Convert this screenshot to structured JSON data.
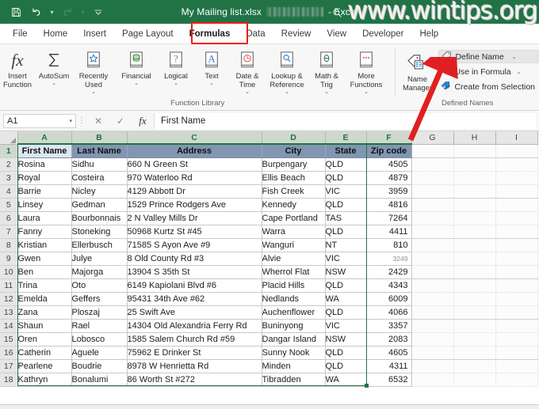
{
  "window": {
    "title": "My Mailing list.xlsx",
    "app_suffix": "- Excel",
    "watermark": "www.wintips.org"
  },
  "quick_access": {
    "save_icon": "save-icon",
    "undo_icon": "undo-icon",
    "redo_icon": "redo-icon",
    "customize_icon": "customize-qat-icon"
  },
  "tabs": [
    {
      "label": "File"
    },
    {
      "label": "Home"
    },
    {
      "label": "Insert"
    },
    {
      "label": "Page Layout"
    },
    {
      "label": "Formulas",
      "active": true
    },
    {
      "label": "Data"
    },
    {
      "label": "Review"
    },
    {
      "label": "View"
    },
    {
      "label": "Developer"
    },
    {
      "label": "Help"
    }
  ],
  "ribbon": {
    "function_library": {
      "group_label": "Function Library",
      "items": [
        {
          "label": "Insert\nFunction",
          "icon": "fx-icon",
          "caret": false
        },
        {
          "label": "AutoSum",
          "icon": "sigma-icon",
          "caret": true
        },
        {
          "label": "Recently\nUsed",
          "icon": "star-book-icon",
          "caret": true
        },
        {
          "label": "Financial",
          "icon": "database-book-icon",
          "caret": true
        },
        {
          "label": "Logical",
          "icon": "question-book-icon",
          "caret": true
        },
        {
          "label": "Text",
          "icon": "letter-a-book-icon",
          "caret": true
        },
        {
          "label": "Date &\nTime",
          "icon": "clock-book-icon",
          "caret": true
        },
        {
          "label": "Lookup &\nReference",
          "icon": "magnifier-book-icon",
          "caret": true
        },
        {
          "label": "Math &\nTrig",
          "icon": "theta-book-icon",
          "caret": true
        },
        {
          "label": "More\nFunctions",
          "icon": "ellipsis-book-icon",
          "caret": true
        }
      ]
    },
    "defined_names": {
      "group_label": "Defined Names",
      "name_manager": {
        "label": "Name\nManager",
        "icon": "name-manager-icon"
      },
      "items": [
        {
          "label": "Define Name",
          "icon": "define-name-icon",
          "caret": true,
          "hovered": true
        },
        {
          "label": "Use in Formula",
          "icon": "use-in-formula-icon",
          "caret": true,
          "hovered": false
        },
        {
          "label": "Create from Selection",
          "icon": "create-from-selection-icon",
          "caret": false,
          "hovered": false
        }
      ]
    }
  },
  "formula_bar": {
    "name_box_value": "A1",
    "cancel_icon": "cancel-icon",
    "enter_icon": "confirm-check-icon",
    "function_icon": "insert-function-icon",
    "formula_value": "First Name"
  },
  "sheet": {
    "column_headers": [
      "A",
      "B",
      "C",
      "D",
      "E",
      "F",
      "G",
      "H",
      "I"
    ],
    "selected_columns": [
      "A",
      "B",
      "C",
      "D",
      "E",
      "F"
    ],
    "row_numbers": [
      1,
      2,
      3,
      4,
      5,
      6,
      7,
      8,
      9,
      10,
      11,
      12,
      13,
      14,
      15,
      16,
      17,
      18
    ],
    "selected_rows": [
      1
    ],
    "header_row": [
      "First Name",
      "Last Name",
      "Address",
      "City",
      "State",
      "Zip code"
    ],
    "rows": [
      {
        "first": "Rosina",
        "last": "Sidhu",
        "address": "660 N Green St",
        "city": "Burpengary",
        "state": "QLD",
        "zip": "4505"
      },
      {
        "first": "Royal",
        "last": "Costeira",
        "address": "970 Waterloo Rd",
        "city": "Ellis Beach",
        "state": "QLD",
        "zip": "4879"
      },
      {
        "first": "Barrie",
        "last": "Nicley",
        "address": "4129 Abbott Dr",
        "city": "Fish Creek",
        "state": "VIC",
        "zip": "3959"
      },
      {
        "first": "Linsey",
        "last": "Gedman",
        "address": "1529 Prince Rodgers Ave",
        "city": "Kennedy",
        "state": "QLD",
        "zip": "4816"
      },
      {
        "first": "Laura",
        "last": "Bourbonnais",
        "address": "2 N Valley Mills Dr",
        "city": "Cape Portland",
        "state": "TAS",
        "zip": "7264"
      },
      {
        "first": "Fanny",
        "last": "Stoneking",
        "address": "50968 Kurtz St #45",
        "city": "Warra",
        "state": "QLD",
        "zip": "4411"
      },
      {
        "first": "Kristian",
        "last": "Ellerbusch",
        "address": "71585 S Ayon Ave #9",
        "city": "Wanguri",
        "state": "NT",
        "zip": "810"
      },
      {
        "first": "Gwen",
        "last": "Julye",
        "address": "8 Old County Rd #3",
        "city": "Alvie",
        "state": "VIC",
        "zip": "3249",
        "zip_small": true
      },
      {
        "first": "Ben",
        "last": "Majorga",
        "address": "13904 S 35th St",
        "city": "Wherrol Flat",
        "state": "NSW",
        "zip": "2429"
      },
      {
        "first": "Trina",
        "last": "Oto",
        "address": "6149 Kapiolani Blvd #6",
        "city": "Placid Hills",
        "state": "QLD",
        "zip": "4343"
      },
      {
        "first": "Emelda",
        "last": "Geffers",
        "address": "95431 34th Ave #62",
        "city": "Nedlands",
        "state": "WA",
        "zip": "6009"
      },
      {
        "first": "Zana",
        "last": "Ploszaj",
        "address": "25 Swift Ave",
        "city": "Auchenflower",
        "state": "QLD",
        "zip": "4066"
      },
      {
        "first": "Shaun",
        "last": "Rael",
        "address": "14304 Old Alexandria Ferry Rd",
        "city": "Buninyong",
        "state": "VIC",
        "zip": "3357"
      },
      {
        "first": "Oren",
        "last": "Lobosco",
        "address": "1585 Salem Church Rd #59",
        "city": "Dangar Island",
        "state": "NSW",
        "zip": "2083"
      },
      {
        "first": "Catherin",
        "last": "Aguele",
        "address": "75962 E Drinker St",
        "city": "Sunny Nook",
        "state": "QLD",
        "zip": "4605"
      },
      {
        "first": "Pearlene",
        "last": "Boudrie",
        "address": "8978 W Henrietta Rd",
        "city": "Minden",
        "state": "QLD",
        "zip": "4311"
      },
      {
        "first": "Kathryn",
        "last": "Bonalumi",
        "address": "86 Worth St #272",
        "city": "Tibradden",
        "state": "WA",
        "zip": "6532"
      }
    ]
  },
  "annotations": {
    "tab_highlight_color": "#ee1b19",
    "arrow_color": "#e02020",
    "arrow_target": "Define Name"
  },
  "colors": {
    "titlebar_green": "#217346",
    "header_row_fill": "#8196b0",
    "active_cell_fill": "#dce6f1",
    "selection_border": "#217346"
  }
}
